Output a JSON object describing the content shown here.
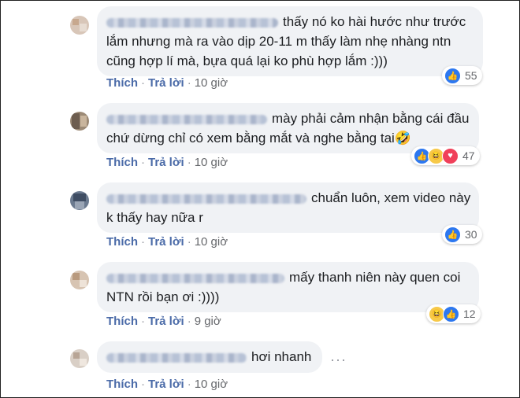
{
  "comments": [
    {
      "lines": [
        "thấy nó ko hài hước như trước",
        "lắm nhưng mà ra vào dịp 20-11 m thấy làm nhẹ nhàng ntn",
        "cũng hợp lí mà, bựa quá lại ko phù hợp lắm :)))"
      ],
      "actions": {
        "like": "Thích",
        "reply": "Trả lời",
        "time": "10 giờ"
      },
      "reactions": {
        "icons": [
          "like-icon"
        ],
        "count": "55"
      }
    },
    {
      "lines": [
        "mày phải cảm nhận bằng cái đầu",
        "chứ dừng chỉ có xem bằng mắt và nghe bằng tai🤣"
      ],
      "actions": {
        "like": "Thích",
        "reply": "Trả lời",
        "time": "10 giờ"
      },
      "reactions": {
        "icons": [
          "like-icon",
          "haha-icon",
          "love-icon"
        ],
        "count": "47"
      }
    },
    {
      "lines": [
        "chuẩn luôn, xem video này",
        "k thấy hay nữa r"
      ],
      "actions": {
        "like": "Thích",
        "reply": "Trả lời",
        "time": "10 giờ"
      },
      "reactions": {
        "icons": [
          "like-icon"
        ],
        "count": "30"
      }
    },
    {
      "lines": [
        "mấy thanh niên này quen coi",
        "NTN rồi bạn ơi :))))"
      ],
      "actions": {
        "like": "Thích",
        "reply": "Trả lời",
        "time": "9 giờ"
      },
      "reactions": {
        "icons": [
          "haha-icon",
          "like-icon"
        ],
        "count": "12"
      }
    },
    {
      "lines": [
        "hơi nhanh"
      ],
      "actions": {
        "like": "Thích",
        "reply": "Trả lời",
        "time": "10 giờ"
      }
    }
  ],
  "more_options_label": "···"
}
